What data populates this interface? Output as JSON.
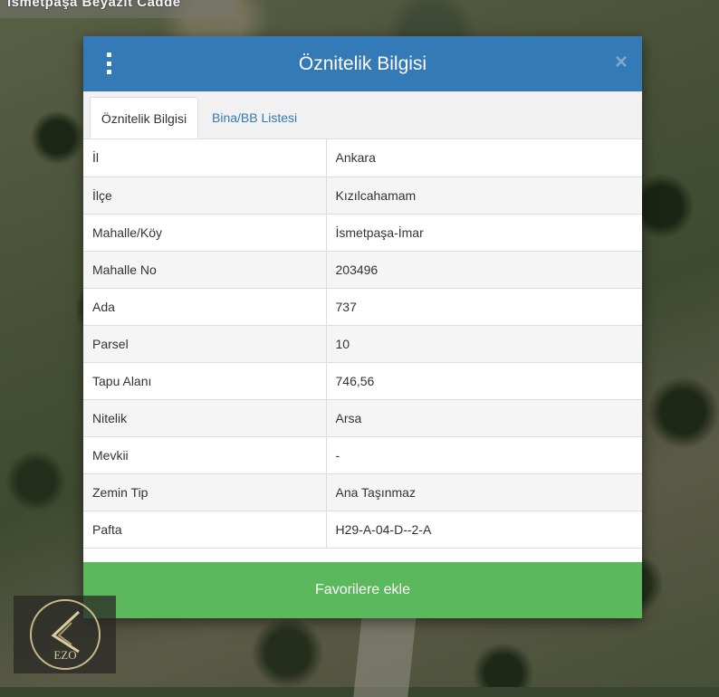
{
  "map": {
    "street_label": "İsmetpaşa Beyazıt Cadde"
  },
  "dialog": {
    "title": "Öznitelik Bilgisi",
    "close_symbol": "×",
    "menu_icon": "vertical-ellipsis-icon",
    "tabs": [
      {
        "label": "Öznitelik Bilgisi",
        "active": true
      },
      {
        "label": "Bina/BB Listesi",
        "active": false
      }
    ],
    "rows": [
      {
        "key": "İl",
        "value": "Ankara"
      },
      {
        "key": "İlçe",
        "value": "Kızılcahamam"
      },
      {
        "key": "Mahalle/Köy",
        "value": "İsmetpaşa-İmar"
      },
      {
        "key": "Mahalle No",
        "value": "203496"
      },
      {
        "key": "Ada",
        "value": "737"
      },
      {
        "key": "Parsel",
        "value": "10"
      },
      {
        "key": "Tapu Alanı",
        "value": "746,56"
      },
      {
        "key": "Nitelik",
        "value": "Arsa"
      },
      {
        "key": "Mevkii",
        "value": "-"
      },
      {
        "key": "Zemin Tip",
        "value": "Ana Taşınmaz"
      },
      {
        "key": "Pafta",
        "value": "H29-A-04-D--2-A"
      }
    ],
    "favorite_button": "Favorilere ekle"
  },
  "logo": {
    "text": "EZO"
  },
  "colors": {
    "header": "#337ab7",
    "favorite_button": "#5cb85c",
    "tab_link": "#337ab7"
  }
}
